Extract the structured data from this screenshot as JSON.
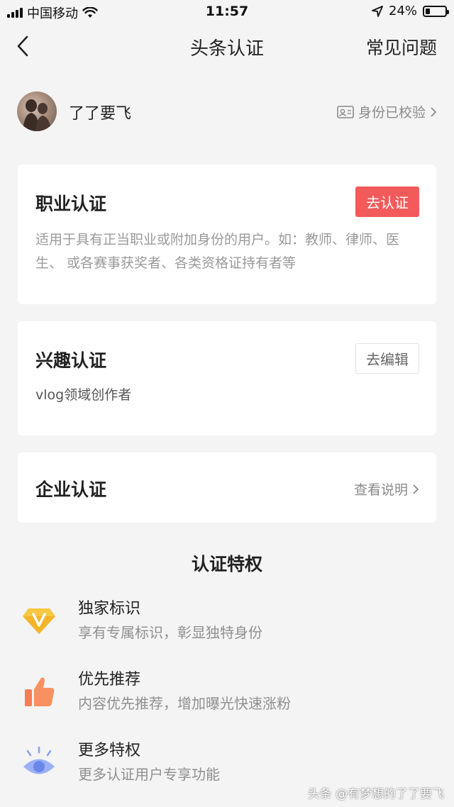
{
  "status_bar": {
    "carrier": "中国移动",
    "time": "11:57",
    "battery_percent": "24%",
    "battery_level": 0.24
  },
  "nav": {
    "title": "头条认证",
    "right": "常见问题"
  },
  "profile": {
    "username": "了了要飞",
    "verified_label": "身份已校验"
  },
  "cards": {
    "profession": {
      "title": "职业认证",
      "button": "去认证",
      "desc": "适用于具有正当职业或附加身份的用户。如：教师、律师、医生、 或各赛事获奖者、各类资格证持有者等"
    },
    "interest": {
      "title": "兴趣认证",
      "button": "去编辑",
      "desc": "vlog领域创作者"
    },
    "enterprise": {
      "title": "企业认证",
      "link": "查看说明"
    }
  },
  "privileges": {
    "title": "认证特权",
    "items": [
      {
        "title": "独家标识",
        "desc": "享有专属标识，彰显独特身份",
        "icon": "diamond-v-icon"
      },
      {
        "title": "优先推荐",
        "desc": "内容优先推荐，增加曝光快速涨粉",
        "icon": "thumbs-up-icon"
      },
      {
        "title": "更多特权",
        "desc": "更多认证用户专享功能",
        "icon": "eye-icon"
      }
    ]
  },
  "watermark": "头条 @有梦想的了了要飞",
  "colors": {
    "accent_red": "#f35a5a",
    "background": "#f4f4f4"
  }
}
